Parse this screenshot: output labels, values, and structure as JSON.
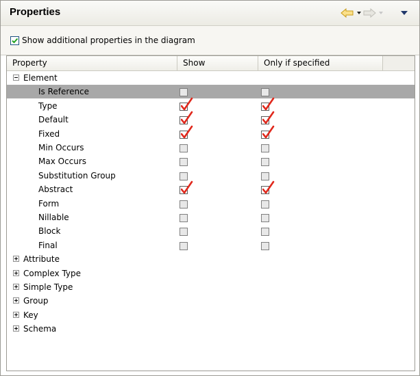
{
  "panel": {
    "title": "Properties",
    "nav": {
      "back_icon": "back-arrow-icon",
      "forward_icon": "forward-arrow-icon",
      "menu_icon": "view-menu-icon"
    }
  },
  "options": {
    "show_additional_label": "Show additional properties in the diagram",
    "show_additional_checked": true
  },
  "table": {
    "headers": [
      "Property",
      "Show",
      "Only if specified",
      ""
    ],
    "element_group": {
      "label": "Element",
      "expanded": true,
      "rows": [
        {
          "label": "Is Reference",
          "show": false,
          "only": false,
          "selected": true
        },
        {
          "label": "Type",
          "show": true,
          "only": true
        },
        {
          "label": "Default",
          "show": true,
          "only": true
        },
        {
          "label": "Fixed",
          "show": true,
          "only": true
        },
        {
          "label": "Min Occurs",
          "show": false,
          "only": false
        },
        {
          "label": "Max Occurs",
          "show": false,
          "only": false
        },
        {
          "label": "Substitution Group",
          "show": false,
          "only": false
        },
        {
          "label": "Abstract",
          "show": true,
          "only": true
        },
        {
          "label": "Form",
          "show": false,
          "only": false
        },
        {
          "label": "Nillable",
          "show": false,
          "only": false
        },
        {
          "label": "Block",
          "show": false,
          "only": false
        },
        {
          "label": "Final",
          "show": false,
          "only": false
        }
      ]
    },
    "collapsed_groups": [
      "Attribute",
      "Complex Type",
      "Simple Type",
      "Group",
      "Key",
      "Schema"
    ]
  },
  "colors": {
    "check_red": "#e0281c",
    "selected_row": "#a8a8a8"
  }
}
